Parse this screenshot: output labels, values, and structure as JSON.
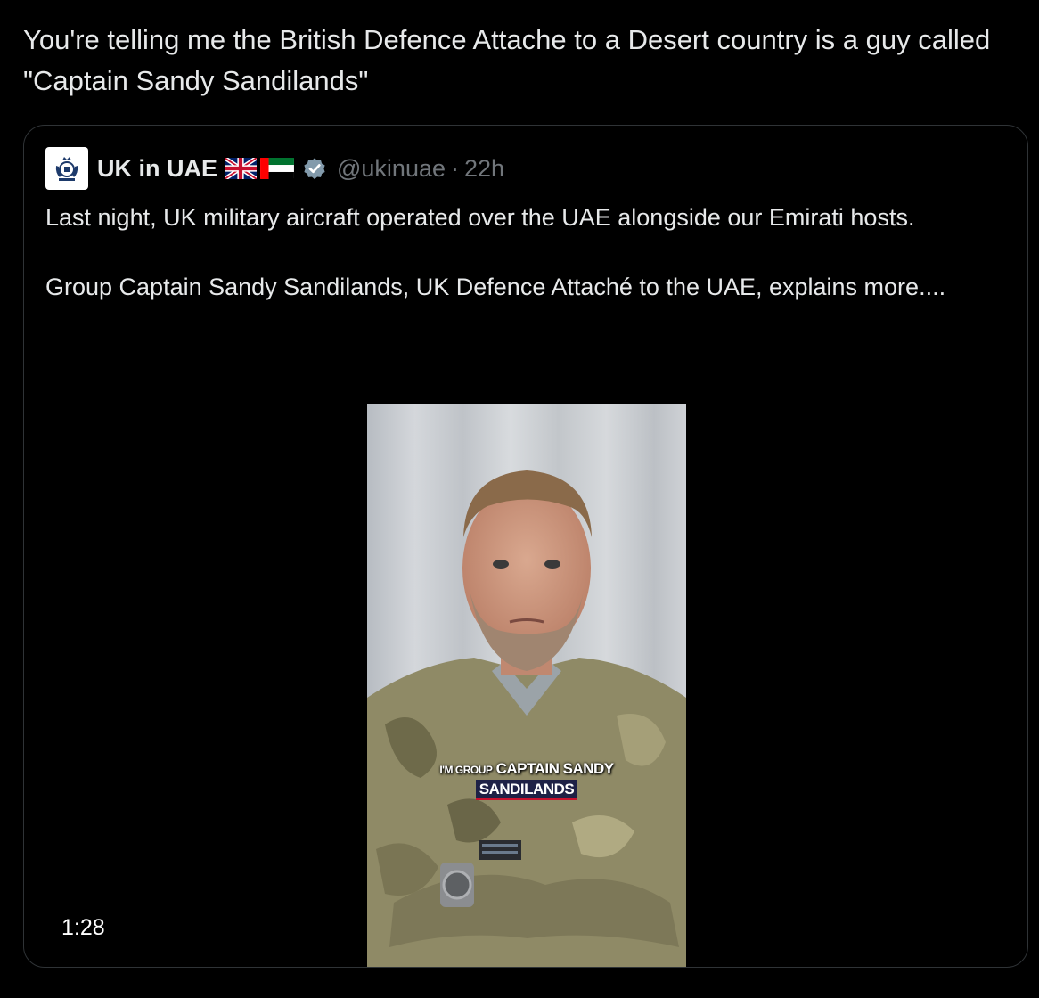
{
  "tweet": {
    "text": "You're telling me the British Defence Attache to a Desert country is a guy called \"Captain Sandy Sandilands\""
  },
  "quoted_tweet": {
    "display_name": "UK in UAE",
    "flags": [
      "uk-flag-icon",
      "uae-flag-icon"
    ],
    "verified": true,
    "handle": "@ukinuae",
    "separator": "·",
    "time": "22h",
    "paragraphs": [
      "Last night, UK military aircraft operated over the UAE alongside our Emirati hosts.",
      "Group Captain Sandy Sandilands, UK Defence Attaché to the UAE, explains more...."
    ],
    "video": {
      "caption_prefix": "I'M GROUP",
      "caption_highlight": "CAPTAIN SANDY",
      "caption_line2": "SANDILANDS",
      "duration": "1:28"
    }
  },
  "colors": {
    "background": "#000000",
    "text": "#e7e9ea",
    "muted": "#71767b",
    "border": "#2f3336",
    "verified_badge": "#829aab"
  }
}
